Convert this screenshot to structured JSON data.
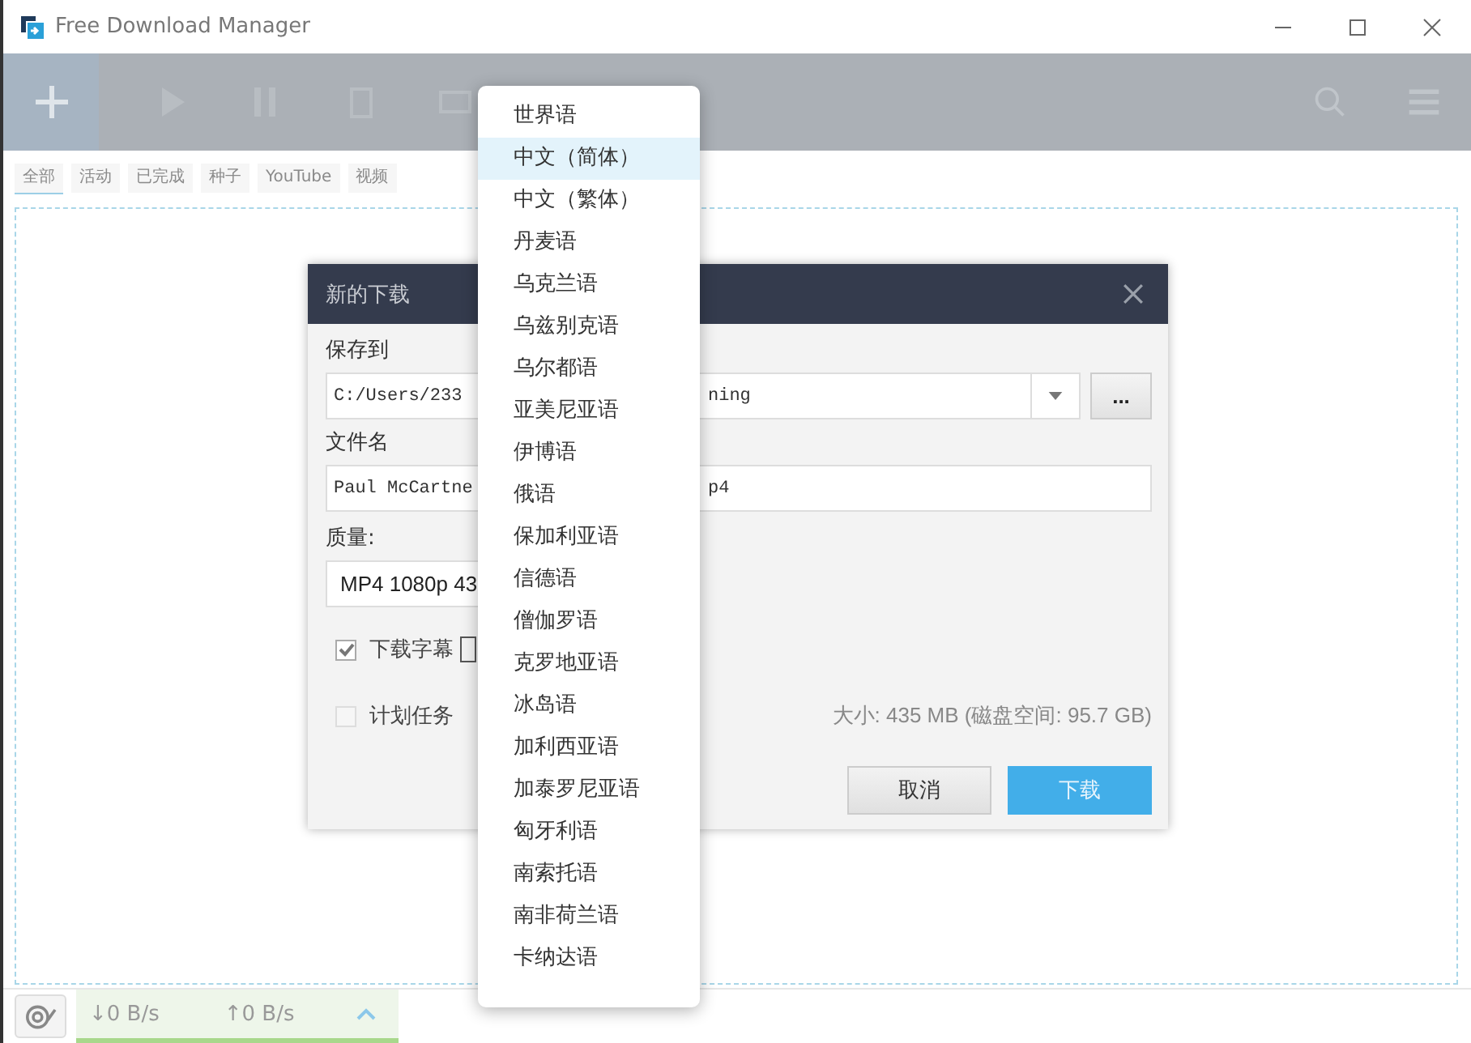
{
  "window": {
    "title": "Free Download Manager"
  },
  "filter_tabs": [
    {
      "label": "全部",
      "selected": true
    },
    {
      "label": "活动",
      "selected": false
    },
    {
      "label": "已完成",
      "selected": false
    },
    {
      "label": "种子",
      "selected": false
    },
    {
      "label": "YouTube",
      "selected": false
    },
    {
      "label": "视频",
      "selected": false
    }
  ],
  "dialog": {
    "title": "新的下载",
    "save_to_label": "保存到",
    "save_to_value_start": "C:/Users/233",
    "save_to_value_end": "ning",
    "browse_button": "...",
    "filename_label": "文件名",
    "filename_value_start": "Paul McCartne",
    "filename_value_end": "p4",
    "quality_label": "质量:",
    "quality_value": "MP4 1080p 43",
    "subtitles": {
      "label": "下载字幕",
      "checked": true
    },
    "schedule": {
      "label": "计划任务",
      "checked": false
    },
    "size_info": "大小: 435 MB (磁盘空间: 95.7 GB)",
    "buttons": [
      {
        "label": "取消",
        "kind": "secondary"
      },
      {
        "label": "下载",
        "kind": "primary"
      }
    ]
  },
  "language_menu": [
    {
      "label": "世界语",
      "selected": false
    },
    {
      "label": "中文（简体）",
      "selected": true
    },
    {
      "label": "中文（繁体）",
      "selected": false
    },
    {
      "label": "丹麦语",
      "selected": false
    },
    {
      "label": "乌克兰语",
      "selected": false
    },
    {
      "label": "乌兹别克语",
      "selected": false
    },
    {
      "label": "乌尔都语",
      "selected": false
    },
    {
      "label": "亚美尼亚语",
      "selected": false
    },
    {
      "label": "伊博语",
      "selected": false
    },
    {
      "label": "俄语",
      "selected": false
    },
    {
      "label": "保加利亚语",
      "selected": false
    },
    {
      "label": "信德语",
      "selected": false
    },
    {
      "label": "僧伽罗语",
      "selected": false
    },
    {
      "label": "克罗地亚语",
      "selected": false
    },
    {
      "label": "冰岛语",
      "selected": false
    },
    {
      "label": "加利西亚语",
      "selected": false
    },
    {
      "label": "加泰罗尼亚语",
      "selected": false
    },
    {
      "label": "匈牙利语",
      "selected": false
    },
    {
      "label": "南索托语",
      "selected": false
    },
    {
      "label": "南非荷兰语",
      "selected": false
    },
    {
      "label": "卡纳达语",
      "selected": false
    }
  ],
  "status_bar": {
    "download_speed": "↓0 B/s",
    "upload_speed": "↑0 B/s"
  }
}
